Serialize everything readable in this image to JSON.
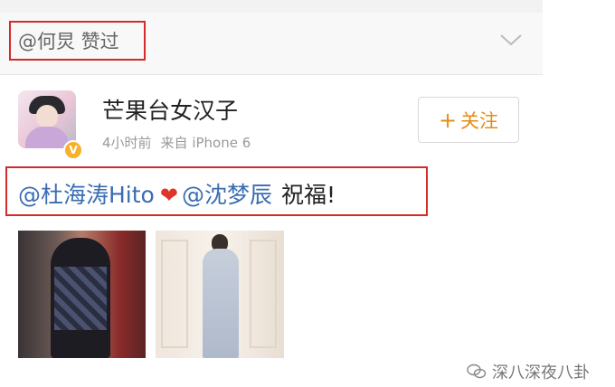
{
  "like_bar": {
    "liked_user": "@何炅",
    "liked_action": "赞过"
  },
  "post": {
    "username": "芒果台女汉子",
    "time": "4小时前",
    "source": "来自 iPhone 6",
    "verified_badge": "V",
    "follow": {
      "plus": "+",
      "label": "关注"
    },
    "content": {
      "mention1": "@杜海涛Hito",
      "heart": "❤",
      "mention2": "@沈梦辰",
      "text": "祝福!"
    }
  },
  "watermark": {
    "text": "深八深夜八卦",
    "icon": "wechat-icon"
  },
  "colors": {
    "mention": "#3a6cb3",
    "follow": "#e58b17",
    "highlight_box": "#d42a2a",
    "badge": "#f6b22a"
  }
}
